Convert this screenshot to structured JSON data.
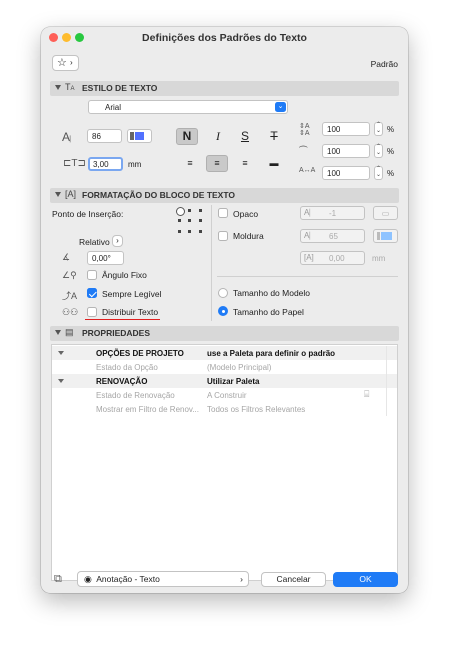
{
  "window": {
    "title": "Definições dos Padrões do Texto",
    "preset": "Padrão"
  },
  "colors": {
    "accent": "#1f7bf6",
    "close": "#fe5f57",
    "minimize": "#febc2e",
    "zoom": "#28c840"
  },
  "text_style": {
    "header": "ESTILO DE TEXTO",
    "font": "Arial",
    "size": "86",
    "height": "3,00",
    "height_unit": "mm",
    "width_factor": "100",
    "spacing": "100",
    "slant": "100",
    "percent": "%",
    "bold": "N",
    "italic": "I",
    "underline": "S",
    "strike": "T"
  },
  "block": {
    "header": "FORMATAÇÃO DO BLOCO DE TEXTO",
    "anchor_label": "Ponto de Inserção:",
    "relative_label": "Relativo",
    "angle": "0,00°",
    "fixed_angle": "Ângulo Fixo",
    "always_readable": "Sempre Legível",
    "distribute": "Distribuir Texto",
    "opaque": "Opaco",
    "opaque_pen": "-1",
    "frame": "Moldura",
    "frame_pen": "65",
    "frame_offset": "0,00",
    "frame_offset_unit": "mm",
    "model_size": "Tamanho do Modelo",
    "paper_size": "Tamanho do Papel"
  },
  "props": {
    "header": "PROPRIEDADES",
    "rows": [
      {
        "name": "OPÇÕES DE PROJETO",
        "value": "use a Paleta para definir o padrão"
      },
      {
        "name": "Estado da Opção",
        "value": "(Modelo Principal)"
      },
      {
        "name": "RENOVAÇÃO",
        "value": "Utilizar Paleta"
      },
      {
        "name": "Estado de Renovação",
        "value": "A Construir"
      },
      {
        "name": "Mostrar em Filtro de Renov...",
        "value": "Todos os Filtros Relevantes"
      }
    ]
  },
  "footer": {
    "layer": "Anotação - Texto",
    "cancel": "Cancelar",
    "ok": "OK"
  }
}
